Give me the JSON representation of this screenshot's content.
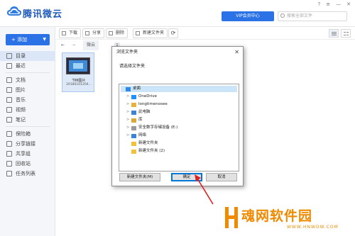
{
  "app": {
    "name": "腾讯微云"
  },
  "header": {
    "vip_label": "VIP会员中心",
    "search_placeholder": "搜索全部文件",
    "window_controls": [
      "?",
      "≡",
      "—",
      "✕"
    ]
  },
  "sidebar": {
    "add_label": "添加",
    "groups": [
      [
        {
          "label": "目录",
          "icon": "folder-icon",
          "active": true
        },
        {
          "label": "最近",
          "icon": "clock-icon",
          "active": false
        }
      ],
      [
        {
          "label": "文档",
          "icon": "document-icon",
          "active": false
        },
        {
          "label": "图片",
          "icon": "image-icon",
          "active": false
        },
        {
          "label": "音乐",
          "icon": "music-icon",
          "active": false
        },
        {
          "label": "视频",
          "icon": "video-icon",
          "active": false
        },
        {
          "label": "笔记",
          "icon": "note-icon",
          "active": false
        }
      ],
      [
        {
          "label": "保险箱",
          "icon": "safe-icon",
          "active": false
        },
        {
          "label": "分享链接",
          "icon": "share-link-icon",
          "active": false
        },
        {
          "label": "共享组",
          "icon": "group-icon",
          "active": false
        },
        {
          "label": "回收站",
          "icon": "trash-icon",
          "active": false
        },
        {
          "label": "任务列表",
          "icon": "task-list-icon",
          "active": false
        }
      ]
    ]
  },
  "toolbar": {
    "buttons": [
      {
        "label": "下载",
        "icon": "download-icon"
      },
      {
        "label": "分享",
        "icon": "share-icon"
      },
      {
        "label": "删除",
        "icon": "delete-icon"
      },
      {
        "label": "新建文件夹",
        "icon": "new-folder-icon"
      }
    ],
    "refresh_icon": "refresh-icon"
  },
  "breadcrumb": {
    "back": "←",
    "forward": "→",
    "root": "微云",
    "count": "1"
  },
  "file": {
    "name": "TIM图片",
    "date": "20180101204..."
  },
  "dialog": {
    "title": "浏览文件夹",
    "prompt": "请选择文件夹",
    "tree": [
      {
        "label": "桌面",
        "level": 0,
        "toggle": "",
        "icon": "desktop-icon",
        "selected": true
      },
      {
        "label": "OneDrive",
        "level": 1,
        "toggle": ">",
        "icon": "cloud-icon",
        "selected": false
      },
      {
        "label": "longtimenosee",
        "level": 1,
        "toggle": ">",
        "icon": "user-icon",
        "selected": false
      },
      {
        "label": "此电脑",
        "level": 1,
        "toggle": ">",
        "icon": "computer-icon",
        "selected": false
      },
      {
        "label": "库",
        "level": 1,
        "toggle": ">",
        "icon": "library-icon",
        "selected": false
      },
      {
        "label": "安全数字存储设备 (E:)",
        "level": 1,
        "toggle": ">",
        "icon": "drive-icon",
        "selected": false
      },
      {
        "label": "网络",
        "level": 1,
        "toggle": ">",
        "icon": "network-icon",
        "selected": false
      },
      {
        "label": "新建文件夹",
        "level": 1,
        "toggle": "",
        "icon": "folder-icon",
        "selected": false
      },
      {
        "label": "新建文件夹 (2)",
        "level": 1,
        "toggle": "",
        "icon": "folder-icon",
        "selected": false
      }
    ],
    "new_folder_label": "新建文件夹(M)",
    "ok_label": "确定",
    "cancel_label": "取消"
  },
  "watermark": {
    "title": "魂网软件园",
    "url": "WWW.HNWDW.COM"
  },
  "colors": {
    "accent": "#2a72e6",
    "annotation": "#e02020",
    "watermark": "#f08a00"
  }
}
